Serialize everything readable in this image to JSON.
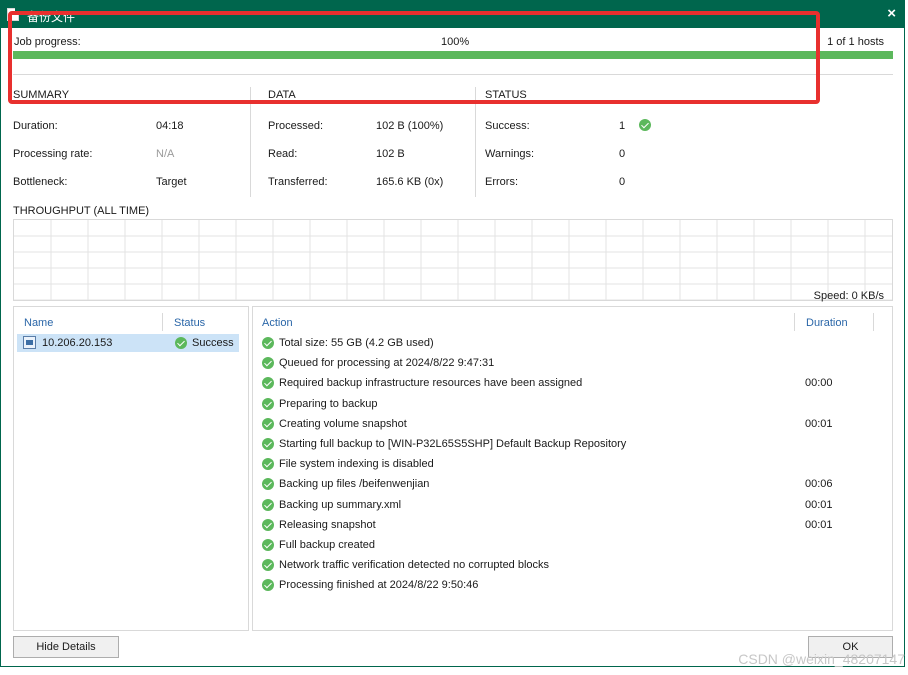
{
  "window": {
    "title": "备份文件",
    "close_glyph": "×"
  },
  "progress": {
    "label": "Job progress:",
    "percent_text": "100%",
    "hosts": "1 of 1 hosts",
    "fraction": 1.0,
    "bar_color": "#5cb85c"
  },
  "summary": {
    "heading": "SUMMARY",
    "rows": [
      {
        "label": "Duration:",
        "value": "04:18"
      },
      {
        "label": "Processing rate:",
        "value": "N/A"
      },
      {
        "label": "Bottleneck:",
        "value": "Target"
      }
    ]
  },
  "data_section": {
    "heading": "DATA",
    "rows": [
      {
        "label": "Processed:",
        "value": "102 B (100%)"
      },
      {
        "label": "Read:",
        "value": "102 B"
      },
      {
        "label": "Transferred:",
        "value": "165.6 KB (0x)"
      }
    ]
  },
  "status_section": {
    "heading": "STATUS",
    "rows": [
      {
        "label": "Success:",
        "value": "1"
      },
      {
        "label": "Warnings:",
        "value": "0"
      },
      {
        "label": "Errors:",
        "value": "0"
      }
    ]
  },
  "throughput": {
    "title": "THROUGHPUT (ALL TIME)",
    "speed": "Speed: 0 KB/s"
  },
  "hosts_table": {
    "columns": [
      "Name",
      "Status"
    ],
    "rows": [
      {
        "name": "10.206.20.153",
        "status": "Success"
      }
    ]
  },
  "actions_table": {
    "columns": [
      "Action",
      "Duration"
    ],
    "rows": [
      {
        "action": "Total size: 55 GB (4.2 GB used)",
        "duration": ""
      },
      {
        "action": "Queued for processing at 2024/8/22 9:47:31",
        "duration": ""
      },
      {
        "action": "Required backup infrastructure resources have been assigned",
        "duration": "00:00"
      },
      {
        "action": "Preparing to backup",
        "duration": ""
      },
      {
        "action": "Creating volume snapshot",
        "duration": "00:01"
      },
      {
        "action": "Starting full backup to [WIN-P32L65S5SHP] Default Backup Repository",
        "duration": ""
      },
      {
        "action": "File system indexing is disabled",
        "duration": ""
      },
      {
        "action": "Backing up files /beifenwenjian",
        "duration": "00:06"
      },
      {
        "action": "Backing up summary.xml",
        "duration": "00:01"
      },
      {
        "action": "Releasing snapshot",
        "duration": "00:01"
      },
      {
        "action": "Full backup created",
        "duration": ""
      },
      {
        "action": "Network traffic verification detected no corrupted blocks",
        "duration": ""
      },
      {
        "action": "Processing finished at 2024/8/22 9:50:46",
        "duration": ""
      }
    ]
  },
  "buttons": {
    "hide_details": "Hide Details",
    "ok": "OK"
  },
  "watermark": "CSDN @weixin_48207147",
  "colors": {
    "titlebar": "#00664d",
    "success": "#5cb85c",
    "link": "#2a66a8",
    "selection": "#cce3f7",
    "annotation": "#e8302e"
  },
  "icons": [
    "document-icon",
    "close-icon",
    "success-check-icon",
    "linux-server-icon"
  ]
}
